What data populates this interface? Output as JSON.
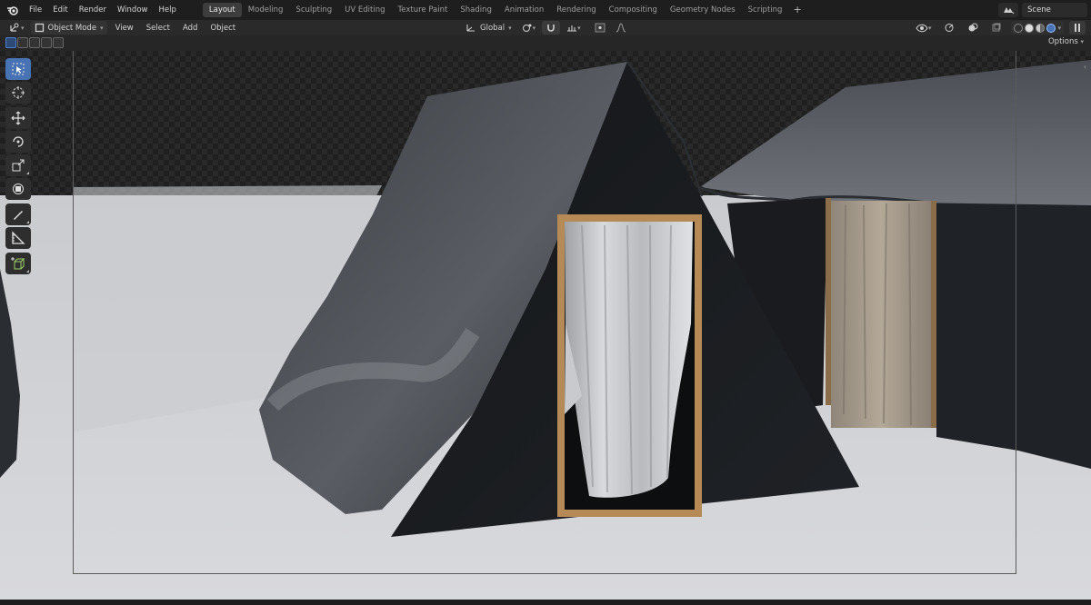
{
  "topbar": {
    "menus": [
      "File",
      "Edit",
      "Render",
      "Window",
      "Help"
    ],
    "workspaces": [
      "Layout",
      "Modeling",
      "Sculpting",
      "UV Editing",
      "Texture Paint",
      "Shading",
      "Animation",
      "Rendering",
      "Compositing",
      "Geometry Nodes",
      "Scripting"
    ],
    "active_workspace": "Layout",
    "add_tab": "+",
    "scene_name": "Scene",
    "icons": {
      "logo": "blender-logo-icon",
      "scene": "scene-icon"
    }
  },
  "header": {
    "mode": "Object Mode",
    "menus": [
      "View",
      "Select",
      "Add",
      "Object"
    ],
    "transform_orientation": "Global",
    "icons": {
      "editor_type": "3d-viewport-editor-icon",
      "pivot": "pivot-point-icon",
      "snap": "snap-magnet-icon",
      "proportional": "proportional-editing-icon"
    }
  },
  "row2": {
    "options": "Options"
  },
  "toolbar": {
    "tools": [
      "select-box-tool",
      "cursor-tool",
      "move-tool",
      "rotate-tool",
      "scale-tool",
      "transform-tool",
      "annotate-tool",
      "measure-tool",
      "add-cube-tool"
    ],
    "active_tool": "select-box-tool"
  },
  "colors": {
    "accent": "#4772b3",
    "floor": "#d7d8dc",
    "tent_fabric": "#1c1e22",
    "door_frame": "#b58a57",
    "curtain": "#c8c9cc",
    "right_curtain": "#a09484"
  }
}
